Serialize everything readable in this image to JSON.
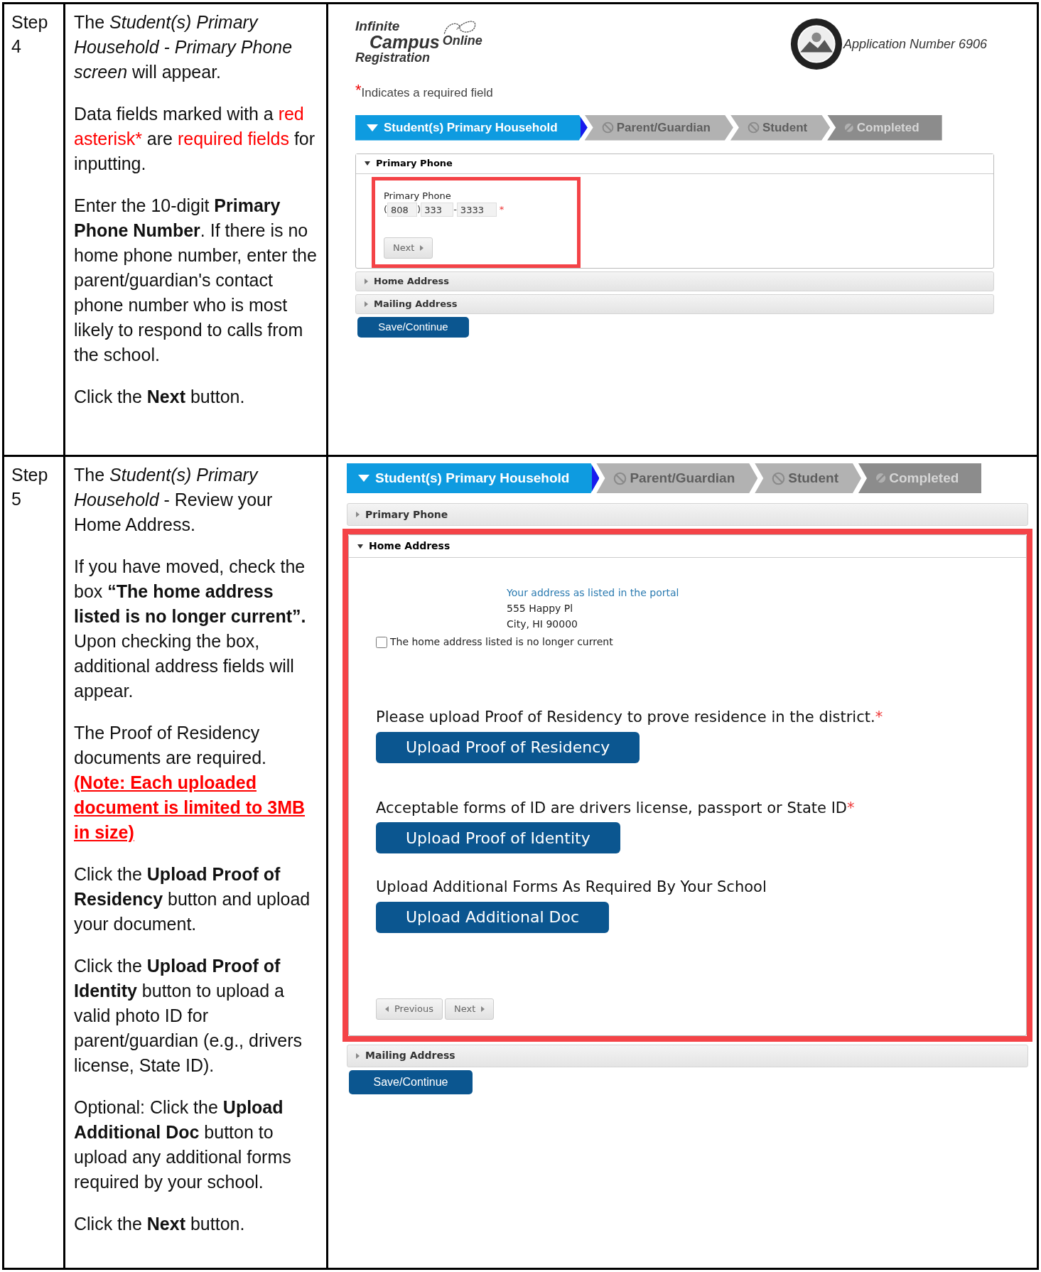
{
  "steps": [
    {
      "label": "Step 4",
      "paragraphs": [
        {
          "kind": "text",
          "runs": [
            {
              "kind": "plain",
              "text": "The *Student(s) Primary Household - Primary Phone screen* will appear."
            }
          ]
        },
        {
          "kind": "text",
          "runs": [
            {
              "kind": "plain",
              "text": "Data fields marked with a "
            },
            {
              "kind": "red",
              "text": "red asterisk*"
            },
            {
              "kind": "plain",
              "text": " are "
            },
            {
              "kind": "red",
              "text": "required fields"
            },
            {
              "kind": "plain",
              "text": " for inputting."
            }
          ]
        },
        {
          "kind": "text",
          "runs": [
            {
              "kind": "plain",
              "text": "Enter the 10-digit **Primary Phone Number**. If there is no home phone number, enter the parent/guardian's contact phone number who is most likely to respond to calls from the school."
            }
          ]
        },
        {
          "kind": "text",
          "runs": [
            {
              "kind": "plain",
              "text": "Click the **Next** button."
            }
          ]
        }
      ],
      "screen": {
        "kind": "full",
        "logo": {
          "line1": "Infinite",
          "line2": "Campus",
          "line3": "Online",
          "line4": "Registration"
        },
        "application": "Application Number 6906",
        "required_note": {
          "mark": "*",
          "text": "Indicates a required field"
        },
        "tabs": [
          {
            "label": "Student(s) Primary Household",
            "selected": true,
            "kind": "step"
          },
          {
            "label": "Parent/Guardian",
            "selected": false,
            "kind": "step"
          },
          {
            "label": "Student",
            "selected": false,
            "kind": "step"
          },
          {
            "label": "Completed",
            "selected": false,
            "kind": "final"
          }
        ],
        "sections": [
          {
            "title": "Primary Phone",
            "expanded": true,
            "kind": "phone",
            "highlighted": true,
            "label": "Primary Phone",
            "open": "(",
            "area": "808",
            "close": ")",
            "prefix": "333",
            "dash": "-",
            "line": "3333",
            "required": true,
            "buttons": [
              {
                "label": "Next",
                "kind": "next"
              }
            ]
          },
          {
            "title": "Home Address",
            "expanded": false
          },
          {
            "title": "Mailing Address",
            "expanded": false
          }
        ],
        "save": "Save/Continue"
      }
    },
    {
      "label": "Step 5",
      "paragraphs": [
        {
          "kind": "text",
          "runs": [
            {
              "kind": "plain",
              "text": "The *Student(s) Primary Household* - Review your Home Address."
            }
          ]
        },
        {
          "kind": "text",
          "runs": [
            {
              "kind": "plain",
              "text": "If you have moved, check the box **“The home address listed is no longer current”.** Upon checking the box, additional address fields will appear."
            }
          ]
        },
        {
          "kind": "text",
          "runs": [
            {
              "kind": "plain",
              "text": "The Proof of Residency documents are required."
            }
          ]
        },
        {
          "kind": "note",
          "runs": [
            {
              "kind": "note",
              "text": "(Note: Each uploaded document is limited to 3MB in size)"
            }
          ]
        },
        {
          "kind": "text",
          "runs": [
            {
              "kind": "plain",
              "text": "Click the **Upload Proof of Residency** button and upload your document."
            }
          ]
        },
        {
          "kind": "text",
          "runs": [
            {
              "kind": "plain",
              "text": "Click the **Upload Proof of Identity** button to upload a valid photo ID for parent/guardian (e.g., drivers license, State ID)."
            }
          ]
        },
        {
          "kind": "text",
          "runs": [
            {
              "kind": "plain",
              "text": "Optional:  Click the **Upload Additional Doc** button to upload any additional forms required by your school."
            }
          ]
        },
        {
          "kind": "text",
          "runs": [
            {
              "kind": "plain",
              "text": "Click the **Next** button."
            }
          ]
        }
      ],
      "screen": {
        "kind": "partial",
        "tabs": [
          {
            "label": "Student(s) Primary Household",
            "selected": true,
            "kind": "step"
          },
          {
            "label": "Parent/Guardian",
            "selected": false,
            "kind": "step"
          },
          {
            "label": "Student",
            "selected": false,
            "kind": "step"
          },
          {
            "label": "Completed",
            "selected": false,
            "kind": "final"
          }
        ],
        "sections": [
          {
            "title": "Primary Phone",
            "expanded": false
          },
          {
            "title": "Home Address",
            "expanded": true,
            "kind": "address",
            "highlighted": true,
            "caption": "Your address as listed in the portal",
            "address_lines": [
              "555 Happy Pl",
              "City, HI 90000"
            ],
            "checkbox": {
              "label": "The home address listed is no longer current",
              "checked": false
            },
            "uploads": [
              {
                "prompt": "Please upload Proof of Residency to prove residence in the district.",
                "required": true,
                "button": "Upload Proof of Residency"
              },
              {
                "prompt": "Acceptable forms of ID are drivers license, passport or State ID",
                "required": true,
                "button": "Upload Proof of Identity"
              },
              {
                "prompt": "Upload Additional Forms As Required By Your School",
                "required": false,
                "button": "Upload Additional Doc"
              }
            ],
            "buttons": [
              {
                "label": "Previous",
                "kind": "previous"
              },
              {
                "label": "Next",
                "kind": "next"
              }
            ]
          },
          {
            "title": "Mailing Address",
            "expanded": false
          }
        ],
        "save": "Save/Continue"
      }
    }
  ]
}
